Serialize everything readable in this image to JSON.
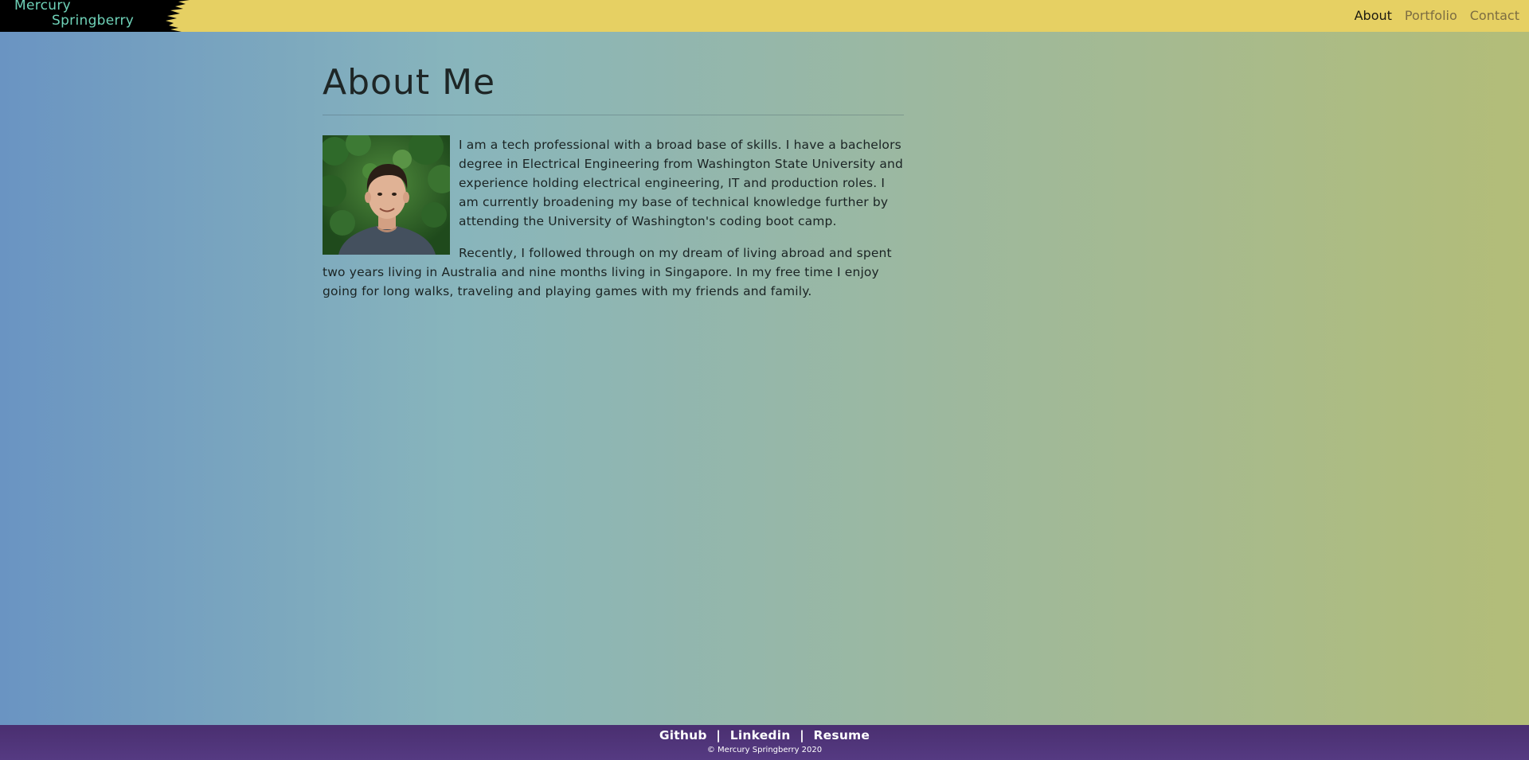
{
  "navbar": {
    "brand_line1": "Mercury",
    "brand_line2": "Springberry",
    "links": [
      {
        "label": "About",
        "active": true
      },
      {
        "label": "Portfolio",
        "active": false
      },
      {
        "label": "Contact",
        "active": false
      }
    ]
  },
  "main": {
    "title": "About Me",
    "paragraphs": [
      "I am a tech professional with a broad base of skills. I have a bachelors degree in Electrical Engineering from Washington State University and experience holding electrical engineering, IT and production roles. I am currently broadening my base of technical knowledge further by attending the University of Washington's coding boot camp.",
      "Recently, I followed through on my dream of living abroad and spent two years living in Australia and nine months living in Singapore. In my free time I enjoy going for long walks, traveling and playing games with my friends and family."
    ]
  },
  "footer": {
    "links": [
      "Github",
      "Linkedin",
      "Resume"
    ],
    "separator": "|",
    "copyright": "© Mercury Springberry 2020"
  },
  "colors": {
    "navbar_bg": "#e6d063",
    "brand_text": "#6fd2b8",
    "brand_bg": "#000000",
    "footer_bg": "#4a2f70",
    "nav_active": "#1c1a10",
    "nav_inactive": "#7c6d42"
  }
}
